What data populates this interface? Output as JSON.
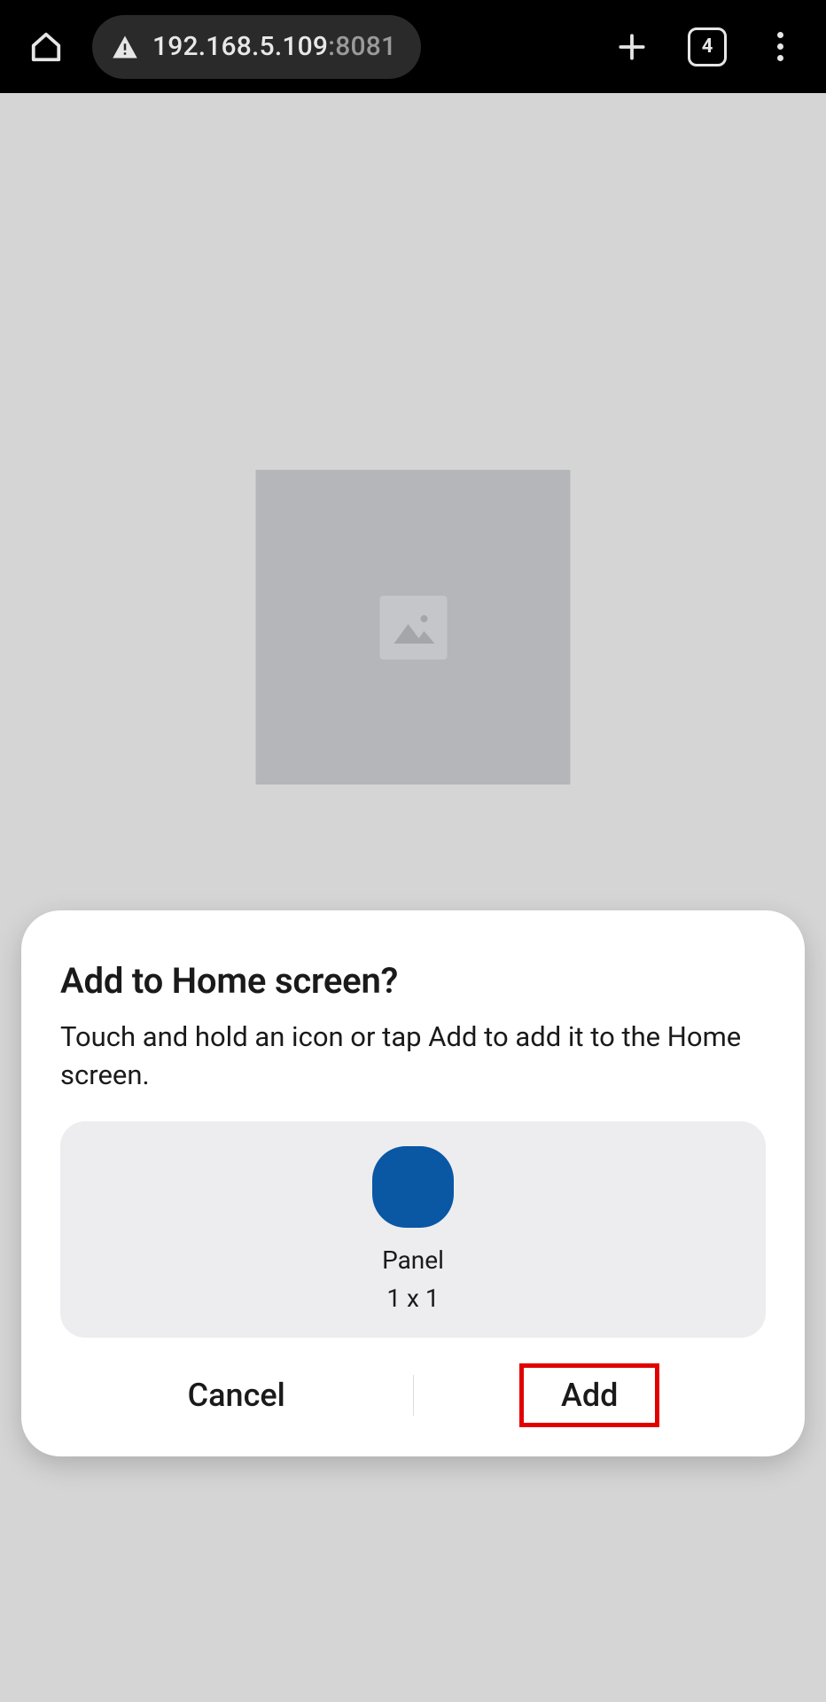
{
  "browser": {
    "address_host": "192.168.5.109",
    "address_port": ":8081",
    "tab_count": "4"
  },
  "dialog": {
    "title": "Add to Home screen?",
    "description": "Touch and hold an icon or tap Add to add it to the Home screen.",
    "preview": {
      "label": "Panel",
      "size": "1 x 1",
      "icon_color": "#0a57a4"
    },
    "buttons": {
      "cancel": "Cancel",
      "add": "Add"
    }
  }
}
